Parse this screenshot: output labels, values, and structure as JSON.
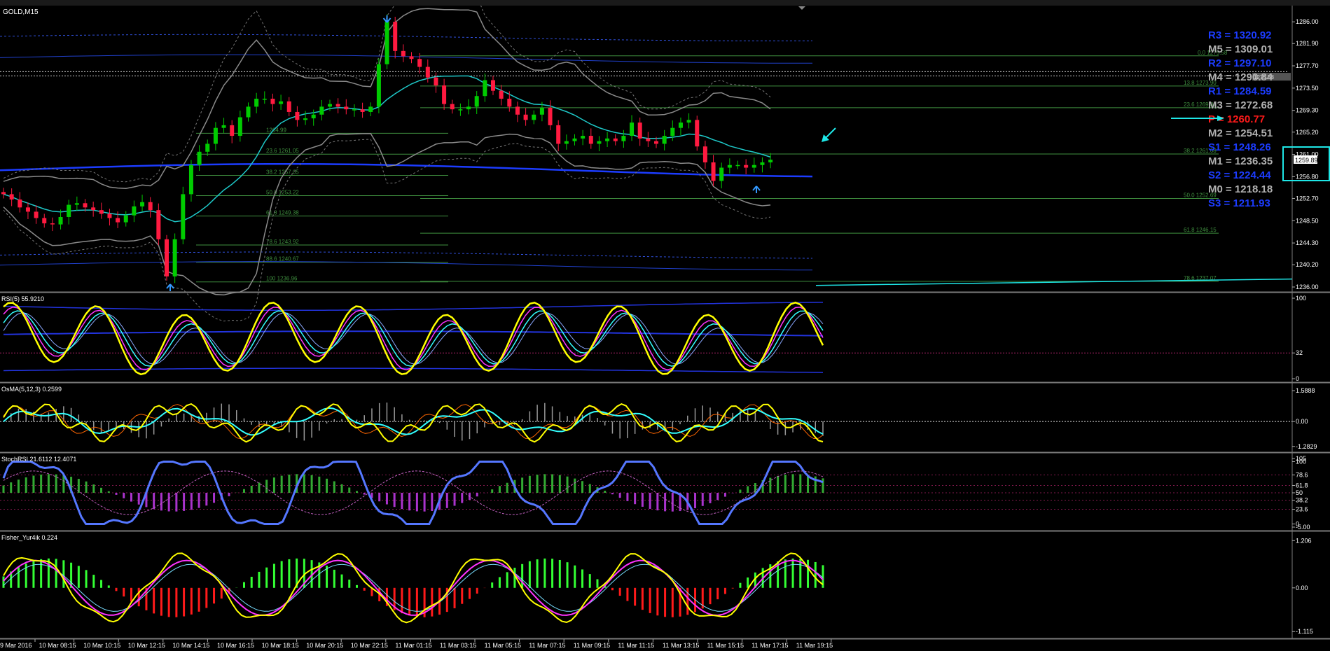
{
  "window": {
    "symbol_title": "GOLD,M15"
  },
  "colors": {
    "background": "#000000",
    "grid": "#2b2b2b",
    "bull": "#00cc00",
    "bear": "#ff1a40",
    "price_axis_text": "#ffffff",
    "blue_level": "#1c3cff",
    "gray_level": "#b0b0b0",
    "red_level": "#ff1a1a",
    "cyan": "#1ee6e6",
    "fib_green": "#3f8f3f",
    "indicator_yellow": "#ffff00",
    "indicator_magenta": "#ff33ff",
    "indicator_cyan": "#33ffff",
    "stoch_blue": "#5577ff",
    "hist_green": "#33aa33",
    "hist_purple": "#aa33cc",
    "fisher_green": "#33ff33",
    "fisher_red": "#ff1a1a"
  },
  "price_axis": {
    "ticks": [
      "1286.00",
      "1281.90",
      "1277.70",
      "1273.50",
      "1269.30",
      "1265.20",
      "1261.00",
      "1256.80",
      "1252.70",
      "1248.50",
      "1244.30",
      "1240.20",
      "1236.00"
    ],
    "current_price": "1259.89",
    "marker_label": "1275.58"
  },
  "pivot_levels": [
    {
      "name": "R3",
      "value": "1320.92",
      "color": "blue"
    },
    {
      "name": "M5",
      "value": "1309.01",
      "color": "gray"
    },
    {
      "name": "R2",
      "value": "1297.10",
      "color": "blue"
    },
    {
      "name": "M4",
      "value": "1290.84",
      "color": "gray"
    },
    {
      "name": "R1",
      "value": "1284.59",
      "color": "blue"
    },
    {
      "name": "M3",
      "value": "1272.68",
      "color": "gray"
    },
    {
      "name": "P",
      "value": "1260.77",
      "color": "red"
    },
    {
      "name": "M2",
      "value": "1254.51",
      "color": "gray"
    },
    {
      "name": "S1",
      "value": "1248.26",
      "color": "blue"
    },
    {
      "name": "M1",
      "value": "1236.35",
      "color": "gray"
    },
    {
      "name": "S2",
      "value": "1224.44",
      "color": "blue"
    },
    {
      "name": "M0",
      "value": "1218.18",
      "color": "gray"
    },
    {
      "name": "S3",
      "value": "1211.93",
      "color": "blue"
    }
  ],
  "fib_left": [
    "1264.99",
    "23.6 1261.05",
    "38.2 1257.05",
    "50.0 1253.22",
    "61.8 1249.38",
    "78.6 1243.92",
    "88.6 1240.67",
    "100 1236.96"
  ],
  "fib_right": [
    "0.0 1279.58",
    "13.8 1273.90",
    "23.6 1269.81",
    "38.2 1261.08",
    "50.0 1252.69",
    "61.8 1246.15",
    "78.6 1237.07"
  ],
  "panels": {
    "rsi": {
      "title": "RSI(5) 55.9210",
      "ticks": [
        "100",
        "32",
        "0"
      ]
    },
    "osma": {
      "title": "OsMA(5,12,3) 0.2599",
      "ticks": [
        "1.5888",
        "0.00",
        "-1.2829"
      ]
    },
    "stoch": {
      "title": "StochRSI 21.6112 12.4071",
      "ticks": [
        "105",
        "100",
        "78.6",
        "61.8",
        "50",
        "38.2",
        "23.6",
        "0",
        "-5.00"
      ]
    },
    "fisher": {
      "title": "Fisher_Yur4ik 0.224",
      "ticks": [
        "1.206",
        "0.00",
        "-1.115"
      ]
    }
  },
  "time_axis": [
    "9 Mar 2016",
    "10 Mar 08:15",
    "10 Mar 10:15",
    "10 Mar 12:15",
    "10 Mar 14:15",
    "10 Mar 16:15",
    "10 Mar 18:15",
    "10 Mar 20:15",
    "10 Mar 22:15",
    "11 Mar 01:15",
    "11 Mar 03:15",
    "11 Mar 05:15",
    "11 Mar 07:15",
    "11 Mar 09:15",
    "11 Mar 11:15",
    "11 Mar 13:15",
    "11 Mar 15:15",
    "11 Mar 17:15",
    "11 Mar 19:15"
  ],
  "chart_data": {
    "type": "candlestick",
    "symbol": "GOLD",
    "timeframe": "M15",
    "ylim": [
      1236.0,
      1288.0
    ],
    "close_series": [
      1253.5,
      1252.5,
      1251.0,
      1250.2,
      1249.0,
      1248.0,
      1247.8,
      1249.2,
      1251.5,
      1251.8,
      1251.0,
      1250.5,
      1249.8,
      1249.0,
      1248.2,
      1249.5,
      1251.2,
      1252.0,
      1250.5,
      1245.0,
      1238.0,
      1245.0,
      1253.5,
      1259.0,
      1261.5,
      1263.0,
      1266.0,
      1266.5,
      1264.5,
      1268.0,
      1270.0,
      1271.5,
      1271.5,
      1270.5,
      1271.0,
      1269.0,
      1267.5,
      1267.8,
      1268.5,
      1270.0,
      1270.5,
      1270.0,
      1269.5,
      1269.5,
      1269.0,
      1270.0,
      1278.0,
      1286.0,
      1280.5,
      1279.5,
      1279.0,
      1277.5,
      1275.5,
      1274.0,
      1270.5,
      1269.5,
      1269.5,
      1270.0,
      1272.0,
      1275.0,
      1273.0,
      1271.5,
      1270.0,
      1268.5,
      1267.5,
      1268.5,
      1269.8,
      1266.5,
      1263.0,
      1263.5,
      1264.0,
      1264.5,
      1263.0,
      1263.5,
      1264.0,
      1263.5,
      1264.5,
      1267.0,
      1264.0,
      1263.5,
      1263.0,
      1264.5,
      1266.0,
      1267.0,
      1267.5,
      1262.5,
      1259.5,
      1256.0,
      1258.5,
      1259.0,
      1259.0,
      1258.5,
      1259.0,
      1259.5,
      1260.0
    ],
    "rsi_last": 55.921,
    "osma_last": 0.2599,
    "stochrsi_last": [
      21.6112,
      12.4071
    ],
    "fisher_last": 0.224
  }
}
